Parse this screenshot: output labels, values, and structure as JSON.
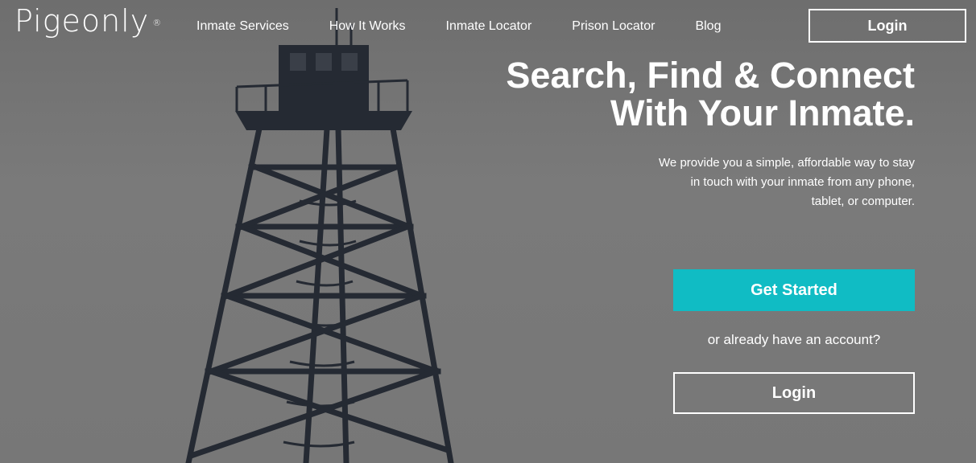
{
  "brand": {
    "logo_text": "Pigeonly",
    "logo_mark": "®"
  },
  "nav": {
    "items": [
      {
        "label": "Inmate Services"
      },
      {
        "label": "How It Works"
      },
      {
        "label": "Inmate Locator"
      },
      {
        "label": "Prison Locator"
      },
      {
        "label": "Blog"
      }
    ],
    "login_label": "Login"
  },
  "hero": {
    "headline_line1": "Search, Find & Connect",
    "headline_line2": "With Your Inmate.",
    "subtext_line1": "We provide you a simple, affordable way to stay",
    "subtext_line2": "in touch with your inmate from any phone,",
    "subtext_line3": "tablet, or computer.",
    "cta_label": "Get Started",
    "or_text": "or already have an account?",
    "login_label": "Login"
  },
  "colors": {
    "accent": "#10bcc4",
    "background": "#767676",
    "tower": "#252a33"
  },
  "background_image": {
    "icon": "watchtower-illustration"
  }
}
